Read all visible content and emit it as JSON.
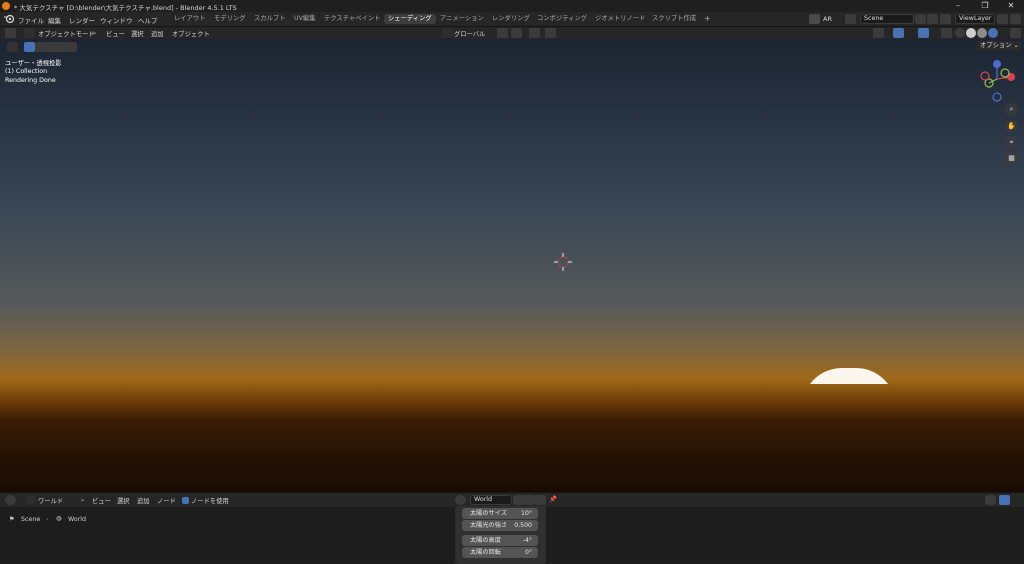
{
  "window": {
    "title": "* 大気テクスチャ [D:\\blender\\大気テクスチャ.blend] - Blender 4.5.1 LTS",
    "controls": [
      "–",
      "❐",
      "✕"
    ]
  },
  "menus": [
    "ファイル",
    "編集",
    "レンダー",
    "ウィンドウ",
    "ヘルプ"
  ],
  "workspaces": [
    {
      "label": "レイアウト",
      "active": false
    },
    {
      "label": "モデリング",
      "active": false
    },
    {
      "label": "スカルプト",
      "active": false
    },
    {
      "label": "UV編集",
      "active": false
    },
    {
      "label": "テクスチャペイント",
      "active": false
    },
    {
      "label": "シェーディング",
      "active": true
    },
    {
      "label": "アニメーション",
      "active": false
    },
    {
      "label": "レンダリング",
      "active": false
    },
    {
      "label": "コンポジティング",
      "active": false
    },
    {
      "label": "ジオメトリノード",
      "active": false
    },
    {
      "label": "スクリプト作成",
      "active": false
    }
  ],
  "add_workspace": "+",
  "top_right": {
    "ar_label": "AR",
    "scene_label": "Scene",
    "viewlayer_label": "ViewLayer"
  },
  "viewport_header": {
    "mode_label": "オブジェクトモード",
    "menus": [
      "ビュー",
      "選択",
      "追加",
      "オブジェクト"
    ],
    "transform_orientation": "グローバル",
    "options_label": "オプション"
  },
  "viewport_overlay": {
    "view_name": "ユーザー・透視投影",
    "collection": "(1) Collection",
    "status": "Rendering Done"
  },
  "gizmo": {
    "x": "X",
    "y": "Y",
    "z": "Z"
  },
  "node_editor_header": {
    "editor_type": "ワールド",
    "menus": [
      "ビュー",
      "選択",
      "追加",
      "ノード"
    ],
    "use_nodes_label": "ノードを使用",
    "use_nodes_checked": true,
    "world_name": "World"
  },
  "breadcrumb": {
    "scene": "Scene",
    "separator": "›",
    "world": "World"
  },
  "sky_props": [
    {
      "label": "太陽のサイズ",
      "value": "10°"
    },
    {
      "label": "太陽光の強さ",
      "value": "0.500"
    },
    {
      "label": "太陽の高度",
      "value": "-4°"
    },
    {
      "label": "太陽の回転",
      "value": "0°"
    }
  ],
  "colors": {
    "accent": "#4772b3",
    "active_tab": "#3d3d3d",
    "header_bg": "#262626",
    "logo": "#e87d0d"
  }
}
